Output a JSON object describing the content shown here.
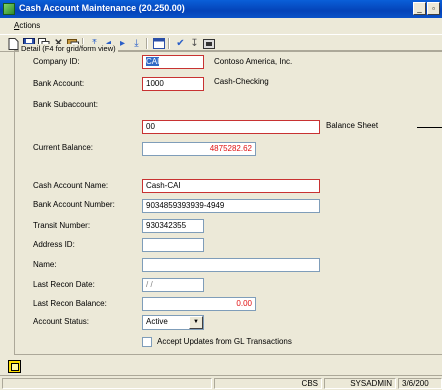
{
  "window": {
    "title": "Cash Account Maintenance (20.250.00)",
    "minimize_label": "_",
    "restore_label": "▫"
  },
  "menu": {
    "actions_label": "Actions"
  },
  "toolbar": {
    "icons": [
      "new-icon",
      "save-icon",
      "copy-icon",
      "delete-icon",
      "paste-icon",
      "first-icon",
      "prev-icon",
      "next-icon",
      "last-icon",
      "list-icon",
      "spell-check-icon",
      "ruler-icon",
      "notes-icon"
    ]
  },
  "panel": {
    "legend": "Detail (F4 for grid/form view)"
  },
  "fields": {
    "company_id": {
      "label": "Company ID:",
      "value": "CAI",
      "desc": "Contoso America, Inc."
    },
    "bank_account": {
      "label": "Bank Account:",
      "value": "1000",
      "desc": "Cash-Checking"
    },
    "bank_subaccount": {
      "label": "Bank Subaccount:",
      "value": "00",
      "desc": "Balance Sheet"
    },
    "current_balance": {
      "label": "Current Balance:",
      "value": "4875282.62"
    },
    "cash_account_name": {
      "label": "Cash Account Name:",
      "value": "Cash-CAI"
    },
    "bank_account_number": {
      "label": "Bank Account Number:",
      "value": "9034859393939-4949"
    },
    "transit_number": {
      "label": "Transit Number:",
      "value": "930342355"
    },
    "address_id": {
      "label": "Address ID:",
      "value": ""
    },
    "name": {
      "label": "Name:",
      "value": ""
    },
    "last_recon_date": {
      "label": "Last Recon Date:",
      "value": " / /"
    },
    "last_recon_balance": {
      "label": "Last Recon Balance:",
      "value": "0.00"
    },
    "account_status": {
      "label": "Account Status:",
      "value": "Active"
    }
  },
  "checkbox": {
    "label": "Accept Updates from GL Transactions",
    "checked": false
  },
  "statusbar": {
    "cells": [
      "",
      "CBS",
      "SYSADMIN",
      "3/6/200"
    ]
  },
  "colors": {
    "titlebar": "#0a5fd8",
    "required_border": "#c83232",
    "numeric_text": "#e01010"
  }
}
